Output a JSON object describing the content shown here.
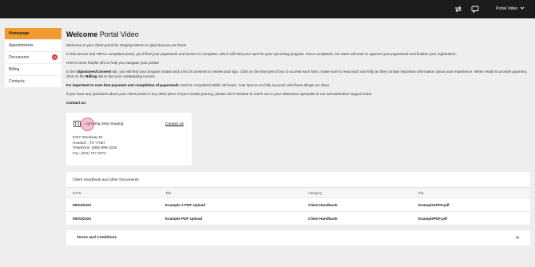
{
  "header": {
    "user_name": "Portal Video",
    "icons": [
      "swap-icon",
      "chat-icon",
      "chevron-down-icon"
    ]
  },
  "sidebar": {
    "items": [
      {
        "label": "Homepage",
        "active": true
      },
      {
        "label": "Appointments"
      },
      {
        "label": "Documents",
        "badge": "11"
      },
      {
        "label": "Billing"
      },
      {
        "label": "Contacts"
      }
    ]
  },
  "main": {
    "title_bold": "Welcome",
    "title_rest": " Portal Video",
    "p1": "Welcome to your client portal for Staging! We're so glad that you are here!",
    "p2": "In this secure and HIPAA-compliant portal, you'll find your paperwork and invoice to complete, which will hold your spot for your upcoming program. Once completed, our team will work to approve your paperwork and finalize your registration.",
    "p3": "Here's some helpful info to help you navigate your portal!",
    "p4_a": "In the ",
    "p4_b": "Signatures/Consent",
    "p4_c": " tab, you will find your program intake and a list of consents to review and sign. Click on the blue pencil box to access each form; make sure to read each one fully as they contain important information about your experience. When ready to provide payment, click on the ",
    "p4_d": "Billing",
    "p4_e": " tab to find your outstanding invoice.",
    "p5_bold": "It's important to note that payment and completion of paperwork",
    "p5_rest": " must be completed within 48 hours. Your spot is not fully secured until these things are done.",
    "p6": "If you have any questions about your client portal or any other piece of your Onsite journey, please don't hesitate to reach out to your admission specialist or our administrative support team.",
    "contact_heading": "Contact us:"
  },
  "contact_card": {
    "office_name": "Lightning Step Staging",
    "contact_link": "Contact us",
    "address_line1": "5757 Woodway Dr",
    "address_line2": "Houston , TX 77057",
    "telephone": "Telephone: (888) 999-2238",
    "fax": "Fax: (222) 737-3373"
  },
  "documents": {
    "title": "Client Handbook and other Documents",
    "columns": [
      "DATE",
      "Title",
      "Category",
      "File"
    ],
    "rows": [
      {
        "date": "05/03/2023",
        "title": "Example 2 PDF Upload",
        "category": "Client Handbook",
        "file": "Example2PDF.pdf"
      },
      {
        "date": "05/03/2023",
        "title": "Example PDF Upload",
        "category": "Client Handbook",
        "file": "ExamplePDF.pdf"
      }
    ]
  },
  "terms": {
    "title": "Terms and Conditions"
  },
  "colors": {
    "topbar": "#1c1c1c",
    "accent": "#f29a2e",
    "badge": "#dd3333",
    "background": "#eeeeee"
  }
}
